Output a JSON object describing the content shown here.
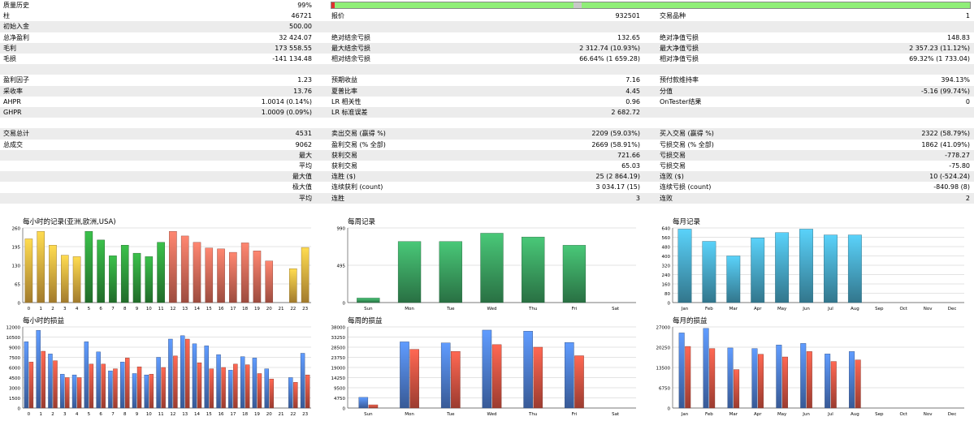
{
  "report": {
    "quality_label": "质量历史",
    "quality_value": "99%",
    "quality_fraction": 0.99,
    "rows": [
      {
        "c": [
          "柱",
          "46721",
          "报价",
          "932501",
          "交易品种",
          "1"
        ]
      },
      {
        "c": [
          "初始入金",
          "500.00",
          "",
          "",
          "",
          ""
        ]
      },
      {
        "c": [
          "总净盈利",
          "32 424.07",
          "绝对结余亏损",
          "132.65",
          "绝对净值亏损",
          "148.83"
        ]
      },
      {
        "c": [
          "毛利",
          "173 558.55",
          "最大结余亏损",
          "2 312.74 (10.93%)",
          "最大净值亏损",
          "2 357.23 (11.12%)"
        ]
      },
      {
        "c": [
          "毛损",
          "-141 134.48",
          "相对结余亏损",
          "66.64% (1 659.28)",
          "相对净值亏损",
          "69.32% (1 733.04)"
        ]
      },
      {
        "c": [
          "",
          "",
          "",
          "",
          "",
          ""
        ]
      },
      {
        "c": [
          "盈利因子",
          "1.23",
          "预期收益",
          "7.16",
          "预付款维持率",
          "394.13%"
        ]
      },
      {
        "c": [
          "采收率",
          "13.76",
          "夏普比率",
          "4.45",
          "分值",
          "-5.16 (99.74%)"
        ]
      },
      {
        "c": [
          "AHPR",
          "1.0014 (0.14%)",
          "LR 相关性",
          "0.96",
          "OnTester结果",
          "0"
        ]
      },
      {
        "c": [
          "GHPR",
          "1.0009 (0.09%)",
          "LR 标准误差",
          "2 682.72",
          "",
          ""
        ]
      },
      {
        "c": [
          "",
          "",
          "",
          "",
          "",
          ""
        ]
      },
      {
        "c": [
          "交易总计",
          "4531",
          "卖出交易 (赢得 %)",
          "2209 (59.03%)",
          "买入交易 (赢得 %)",
          "2322 (58.79%)"
        ]
      },
      {
        "c": [
          "总成交",
          "9062",
          "盈利交易 (% 全部)",
          "2669 (58.91%)",
          "亏损交易 (% 全部)",
          "1862 (41.09%)"
        ]
      },
      {
        "c": [
          "",
          "最大",
          "获利交易",
          "721.66",
          "亏损交易",
          "-778.27"
        ],
        "ra": true
      },
      {
        "c": [
          "",
          "平均",
          "获利交易",
          "65.03",
          "亏损交易",
          "-75.80"
        ],
        "ra": true
      },
      {
        "c": [
          "",
          "最大值",
          "连胜 ($)",
          "25 (2 864.19)",
          "连败 ($)",
          "10 (-524.24)"
        ],
        "ra": true
      },
      {
        "c": [
          "",
          "极大值",
          "连续获利 (count)",
          "3 034.17 (15)",
          "连续亏损 (count)",
          "-840.98 (8)"
        ],
        "ra": true
      },
      {
        "c": [
          "",
          "平均",
          "连胜",
          "3",
          "连败",
          "2"
        ],
        "ra": true
      },
      {
        "c": [
          "",
          "",
          "",
          "",
          "",
          ""
        ]
      }
    ]
  },
  "chart_data": [
    {
      "type": "bar",
      "title": "每小时的记录(亚洲,欧洲,USA)",
      "categories": [
        "0",
        "1",
        "2",
        "3",
        "4",
        "5",
        "6",
        "7",
        "8",
        "9",
        "10",
        "11",
        "12",
        "13",
        "14",
        "15",
        "16",
        "17",
        "18",
        "19",
        "20",
        "21",
        "22",
        "23"
      ],
      "values": [
        222,
        248,
        200,
        165,
        160,
        248,
        218,
        163,
        200,
        172,
        160,
        210,
        248,
        232,
        210,
        190,
        187,
        175,
        208,
        180,
        145,
        0,
        118,
        192
      ],
      "colors": [
        "#e8b040",
        "#e8b040",
        "#e8b040",
        "#e8b040",
        "#e8b040",
        "#2f9a3c",
        "#2f9a3c",
        "#2f9a3c",
        "#2f9a3c",
        "#2f9a3c",
        "#2f9a3c",
        "#2f9a3c",
        "#e06c5a",
        "#e06c5a",
        "#e06c5a",
        "#e06c5a",
        "#e06c5a",
        "#e06c5a",
        "#e06c5a",
        "#e06c5a",
        "#e06c5a",
        "#e8b040",
        "#e8b040",
        "#e8b040"
      ],
      "ylim": [
        0,
        260
      ],
      "yticks": [
        "0",
        "65",
        "130",
        "195",
        "260"
      ]
    },
    {
      "type": "bar",
      "title": "每周记录",
      "categories": [
        "Sun",
        "Mon",
        "Tue",
        "Wed",
        "Thu",
        "Fri",
        "Sat"
      ],
      "values": [
        60,
        810,
        810,
        920,
        870,
        760,
        0
      ],
      "colors": [
        "#3aa060",
        "#3aa060",
        "#3aa060",
        "#3aa060",
        "#3aa060",
        "#3aa060",
        "#3aa060"
      ],
      "ylim": [
        0,
        990
      ],
      "yticks": [
        "0",
        "495",
        "990"
      ]
    },
    {
      "type": "bar",
      "title": "每月记录",
      "categories": [
        "Jan",
        "Feb",
        "Mar",
        "Apr",
        "May",
        "Jun",
        "Jul",
        "Aug",
        "Sep",
        "Oct",
        "Nov",
        "Dec"
      ],
      "values": [
        630,
        525,
        400,
        555,
        600,
        630,
        580,
        580,
        0,
        0,
        0,
        0
      ],
      "colors": [
        "#48a8c8",
        "#48a8c8",
        "#48a8c8",
        "#48a8c8",
        "#48a8c8",
        "#48a8c8",
        "#48a8c8",
        "#48a8c8",
        "#48a8c8",
        "#48a8c8",
        "#48a8c8",
        "#48a8c8"
      ],
      "ylim": [
        0,
        640
      ],
      "yticks": [
        "0",
        "80",
        "160",
        "240",
        "320",
        "400",
        "480",
        "560",
        "640"
      ]
    },
    {
      "type": "bar",
      "title": "每小时的损益",
      "categories": [
        "0",
        "1",
        "2",
        "3",
        "4",
        "5",
        "6",
        "7",
        "8",
        "9",
        "10",
        "11",
        "12",
        "13",
        "14",
        "15",
        "16",
        "17",
        "18",
        "19",
        "20",
        "21",
        "22",
        "23"
      ],
      "series": [
        {
          "values": [
            9800,
            11500,
            8000,
            5000,
            4900,
            9800,
            8300,
            5500,
            6800,
            5100,
            4900,
            7500,
            10200,
            10700,
            9500,
            9200,
            7900,
            5600,
            7600,
            7400,
            5800,
            0,
            4500,
            8100
          ]
        },
        {
          "values": [
            6800,
            8400,
            7000,
            4500,
            4500,
            6500,
            6500,
            5800,
            7400,
            6100,
            5000,
            6000,
            7700,
            10200,
            6700,
            5800,
            6000,
            6500,
            6400,
            5100,
            4300,
            0,
            3800,
            4900
          ]
        }
      ],
      "ylim": [
        0,
        12000
      ],
      "yticks": [
        "0",
        "1500",
        "3000",
        "4500",
        "6000",
        "7500",
        "9000",
        "10500",
        "12000"
      ]
    },
    {
      "type": "bar",
      "title": "每周的损益",
      "categories": [
        "Sun",
        "Mon",
        "Tue",
        "Wed",
        "Thu",
        "Fri",
        "Sat"
      ],
      "series": [
        {
          "values": [
            5000,
            31000,
            30500,
            36500,
            36000,
            30700,
            0
          ]
        },
        {
          "values": [
            1500,
            27500,
            26500,
            29700,
            28500,
            24500,
            0
          ]
        }
      ],
      "ylim": [
        0,
        38000
      ],
      "yticks": [
        "0",
        "4750",
        "9500",
        "14250",
        "19000",
        "23750",
        "28500",
        "33250",
        "38000"
      ]
    },
    {
      "type": "bar",
      "title": "每月的损益",
      "categories": [
        "Jan",
        "Feb",
        "Mar",
        "Apr",
        "May",
        "Jun",
        "Jul",
        "Aug",
        "Sep",
        "Oct",
        "Nov",
        "Dec"
      ],
      "series": [
        {
          "values": [
            25000,
            26500,
            20000,
            19800,
            21000,
            21500,
            18000,
            18800,
            0,
            0,
            0,
            0
          ]
        },
        {
          "values": [
            20500,
            19800,
            12800,
            17900,
            17000,
            18800,
            15500,
            16000,
            0,
            0,
            0,
            0
          ]
        }
      ],
      "ylim": [
        0,
        27000
      ],
      "yticks": [
        "0",
        "6750",
        "13500",
        "20250",
        "27000"
      ]
    }
  ],
  "colors": {
    "profit": "#4a78c8",
    "loss": "#d05040",
    "grid": "#c8c8c8",
    "row_shade": "#ececec",
    "quality_bar": "#90ee78"
  }
}
